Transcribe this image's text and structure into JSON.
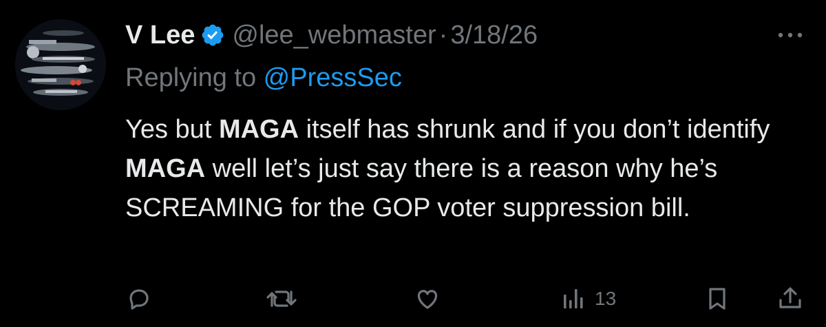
{
  "tweet": {
    "author_name": "V Lee",
    "handle": "@lee_webmaster",
    "separator": "·",
    "date": "3/18/26",
    "replying_prefix": "Replying to ",
    "replying_to": "@PressSec",
    "body": {
      "s1": "Yes but ",
      "b1": "MAGA",
      "s2": " itself has shrunk and if you don’t identify ",
      "b2": "MAGA",
      "s3": " well let’s just say there is a reason why he’s SCREAMING for the GOP voter suppression bill."
    }
  },
  "actions": {
    "views_count": "13"
  },
  "icons": {
    "verified": "verified-badge-icon",
    "more": "more-dots-icon",
    "reply": "reply-icon",
    "retweet": "retweet-icon",
    "like": "heart-icon",
    "views": "views-bar-icon",
    "bookmark": "bookmark-icon",
    "share": "share-icon"
  },
  "colors": {
    "background": "#000000",
    "text": "#e7e9ea",
    "muted": "#71767b",
    "accent": "#1d9bf0"
  }
}
